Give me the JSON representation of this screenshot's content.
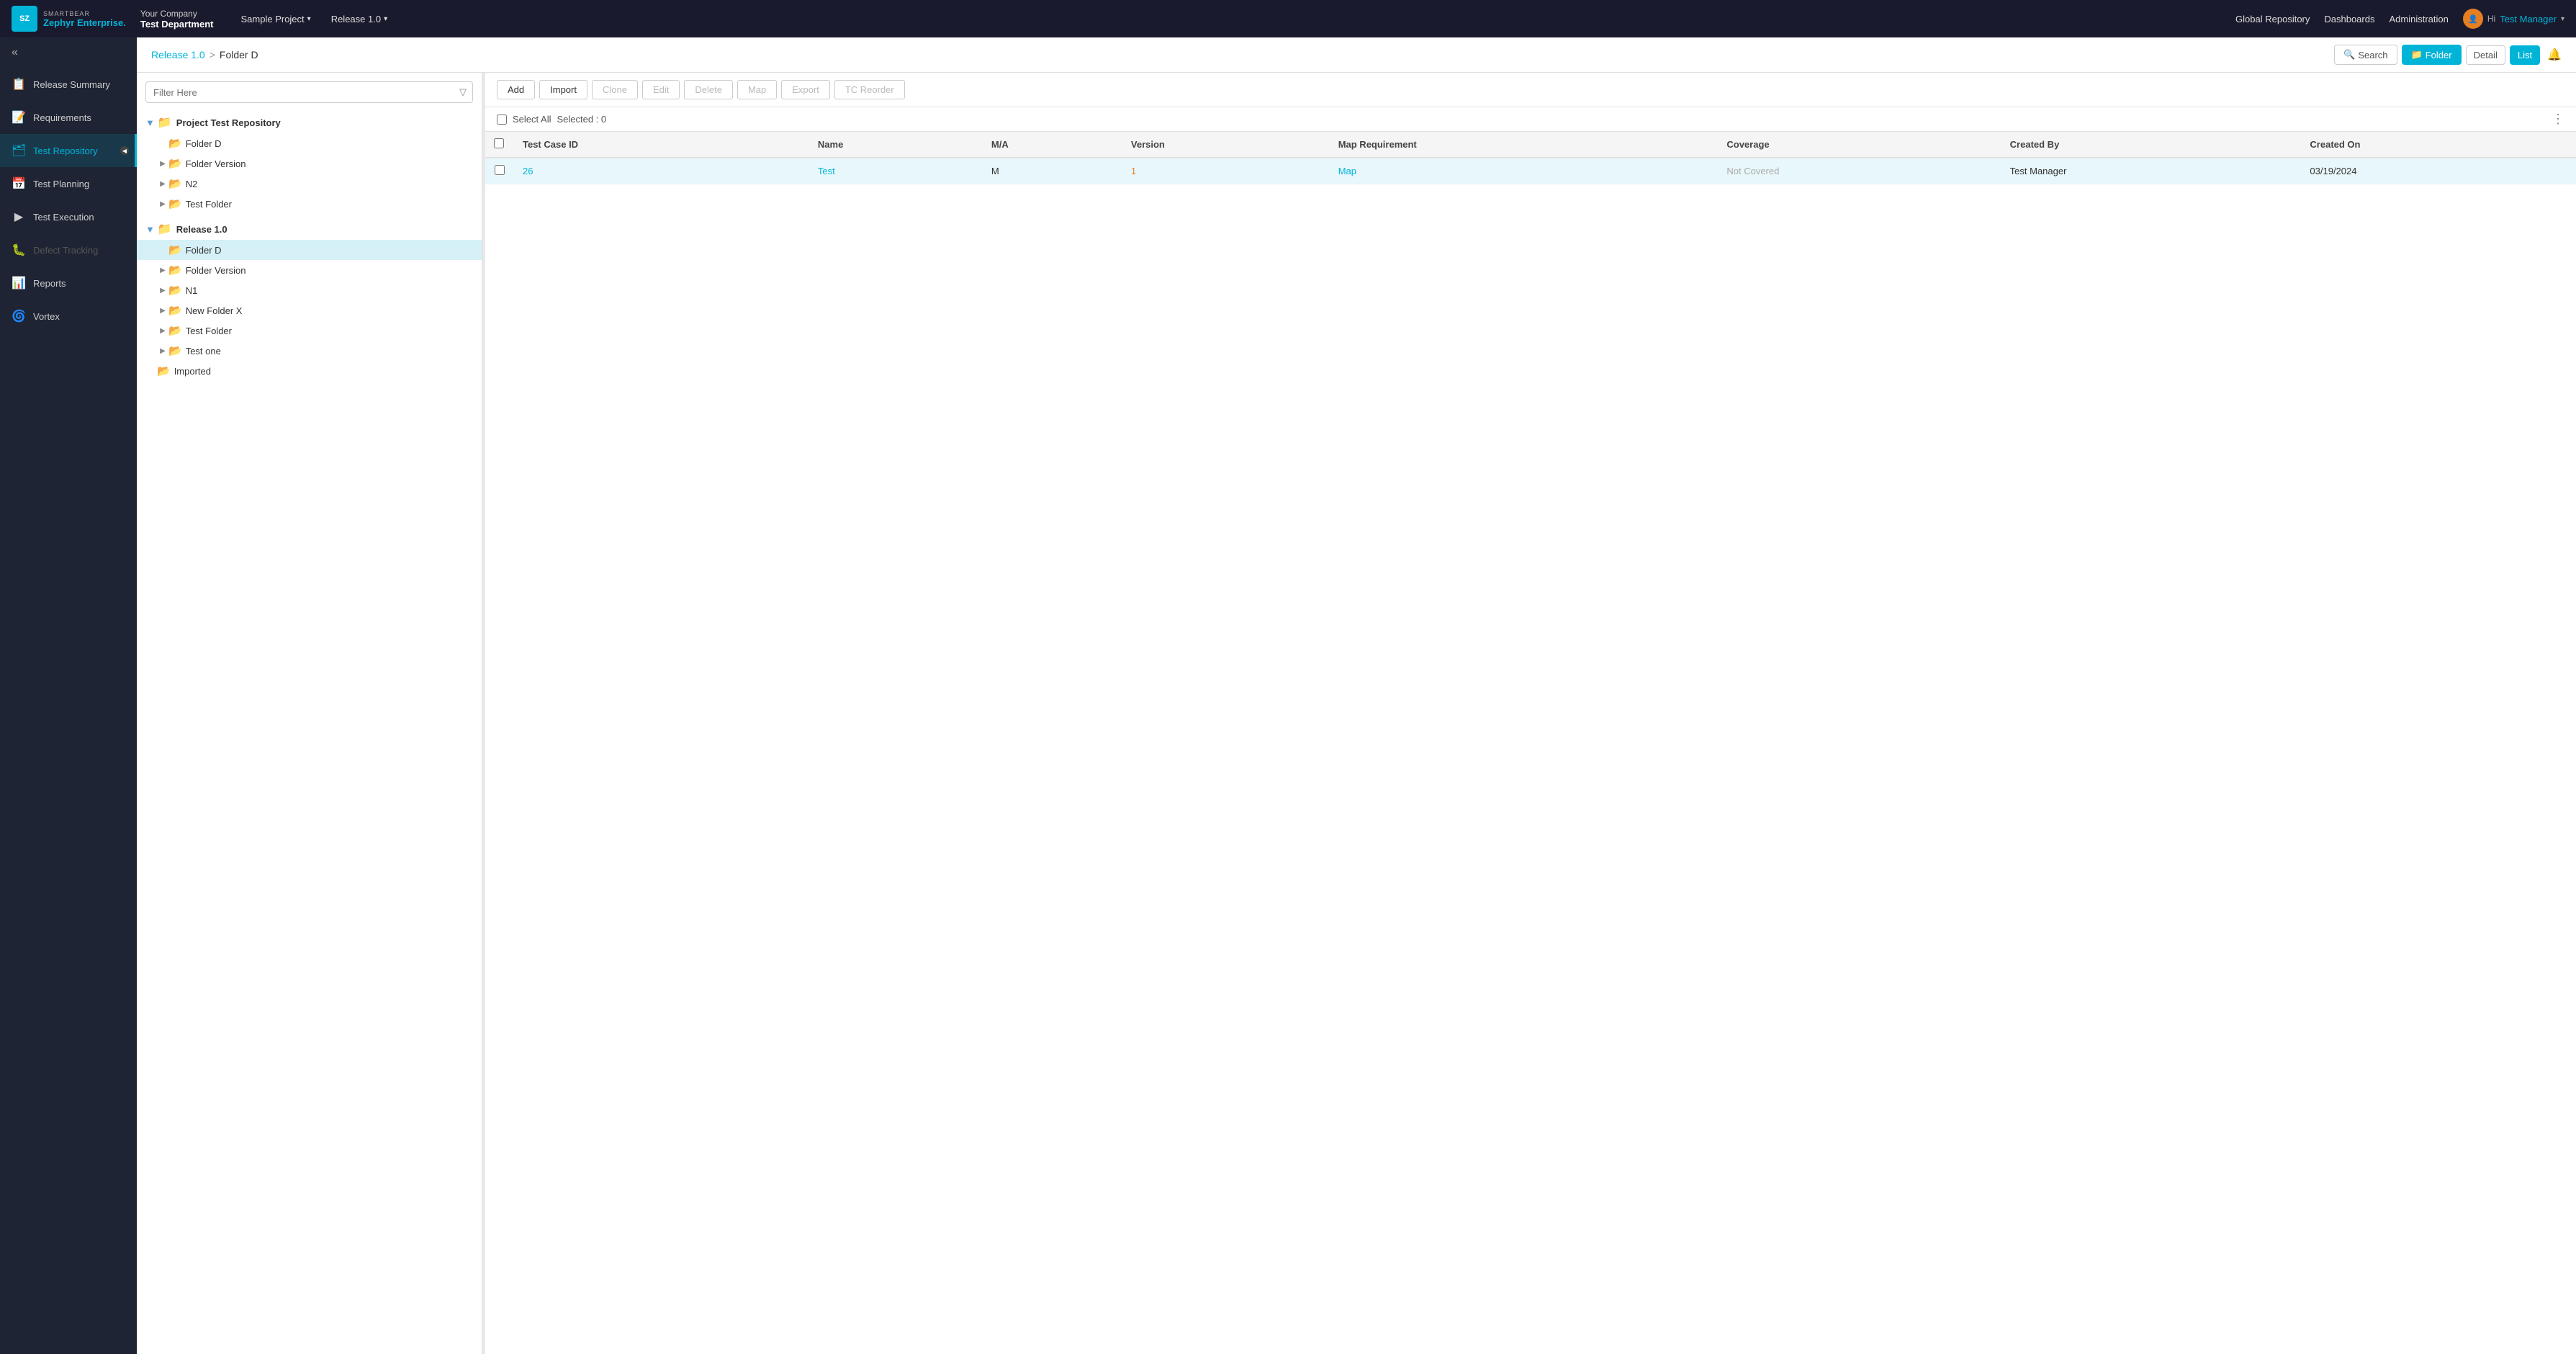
{
  "app": {
    "logo_text": "SMARTBEAR",
    "logo_sub": "Zephyr Enterprise.",
    "logo_abbr": "SZ"
  },
  "header": {
    "company": "Your Company",
    "department": "Test Department",
    "project_label": "Sample Project",
    "release_label": "Release 1.0",
    "global_repo": "Global Repository",
    "dashboards": "Dashboards",
    "administration": "Administration",
    "hi_text": "Hi",
    "user_name": "Test Manager"
  },
  "sidebar": {
    "toggle_icon": "«",
    "items": [
      {
        "id": "release-summary",
        "label": "Release Summary",
        "icon": "📋"
      },
      {
        "id": "requirements",
        "label": "Requirements",
        "icon": "📝"
      },
      {
        "id": "test-repository",
        "label": "Test Repository",
        "icon": "🗂",
        "active": true
      },
      {
        "id": "test-planning",
        "label": "Test Planning",
        "icon": "📅"
      },
      {
        "id": "test-execution",
        "label": "Test Execution",
        "icon": "▶"
      },
      {
        "id": "defect-tracking",
        "label": "Defect Tracking",
        "icon": "🐛",
        "disabled": true
      },
      {
        "id": "reports",
        "label": "Reports",
        "icon": "📊"
      },
      {
        "id": "vortex",
        "label": "Vortex",
        "icon": "🌀"
      }
    ]
  },
  "breadcrumb": {
    "parts": [
      {
        "text": "Release 1.0",
        "link": true
      },
      {
        "text": ">",
        "sep": true
      },
      {
        "text": "Folder D",
        "link": false
      }
    ]
  },
  "breadcrumb_actions": {
    "search_label": "Search",
    "folder_label": "Folder",
    "detail_label": "Detail",
    "list_label": "List"
  },
  "filter": {
    "placeholder": "Filter Here"
  },
  "tree": {
    "project_section": "Project Test Repository",
    "project_folders": [
      {
        "label": "Folder D",
        "level": 1,
        "expandable": false
      },
      {
        "label": "Folder Version",
        "level": 1,
        "expandable": true
      },
      {
        "label": "N2",
        "level": 1,
        "expandable": true
      },
      {
        "label": "Test Folder",
        "level": 1,
        "expandable": true
      }
    ],
    "release_section": "Release 1.0",
    "release_folders": [
      {
        "label": "Folder D",
        "level": 1,
        "expandable": false,
        "selected": true
      },
      {
        "label": "Folder Version",
        "level": 1,
        "expandable": true
      },
      {
        "label": "N1",
        "level": 1,
        "expandable": true
      },
      {
        "label": "New Folder X",
        "level": 1,
        "expandable": true
      },
      {
        "label": "Test Folder",
        "level": 1,
        "expandable": true
      },
      {
        "label": "Test one",
        "level": 1,
        "expandable": true
      }
    ],
    "imported_section": "Imported"
  },
  "toolbar": {
    "add_label": "Add",
    "import_label": "Import",
    "clone_label": "Clone",
    "edit_label": "Edit",
    "delete_label": "Delete",
    "map_label": "Map",
    "export_label": "Export",
    "tc_reorder_label": "TC Reorder"
  },
  "selection_bar": {
    "select_all_label": "Select All",
    "selected_label": "Selected : 0"
  },
  "table": {
    "columns": [
      {
        "key": "check",
        "label": ""
      },
      {
        "key": "test_case_id",
        "label": "Test Case ID"
      },
      {
        "key": "name",
        "label": "Name"
      },
      {
        "key": "ma",
        "label": "M/A"
      },
      {
        "key": "version",
        "label": "Version"
      },
      {
        "key": "map_requirement",
        "label": "Map Requirement"
      },
      {
        "key": "coverage",
        "label": "Coverage"
      },
      {
        "key": "created_by",
        "label": "Created By"
      },
      {
        "key": "created_on",
        "label": "Created On"
      }
    ],
    "rows": [
      {
        "test_case_id": "26",
        "name": "Test",
        "ma": "M",
        "version": "1",
        "map_requirement": "Map",
        "coverage": "Not Covered",
        "created_by": "Test Manager",
        "created_on": "03/19/2024",
        "highlighted": true
      }
    ]
  },
  "colors": {
    "accent": "#00b4d8",
    "link": "#00b4d8",
    "version": "#e67e22",
    "coverage_na": "#aaa",
    "active_bg": "#d6f0f7"
  }
}
